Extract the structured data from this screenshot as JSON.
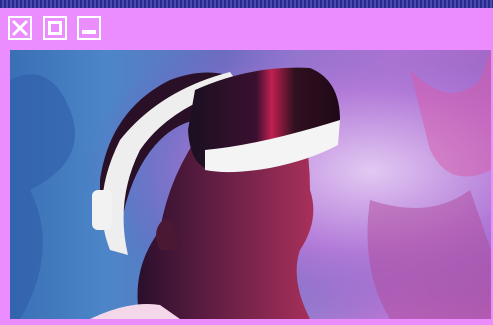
{
  "window": {
    "controls": [
      {
        "name": "close",
        "icon": "close-icon"
      },
      {
        "name": "maximize",
        "icon": "maximize-icon"
      },
      {
        "name": "minimize",
        "icon": "minimize-icon"
      }
    ]
  },
  "photo": {
    "subject": "vr-headset-photo"
  },
  "colors": {
    "window_bg": "#eb8cff",
    "button_border": "#ffffff",
    "desktop_bg": "#1c1f7a"
  }
}
